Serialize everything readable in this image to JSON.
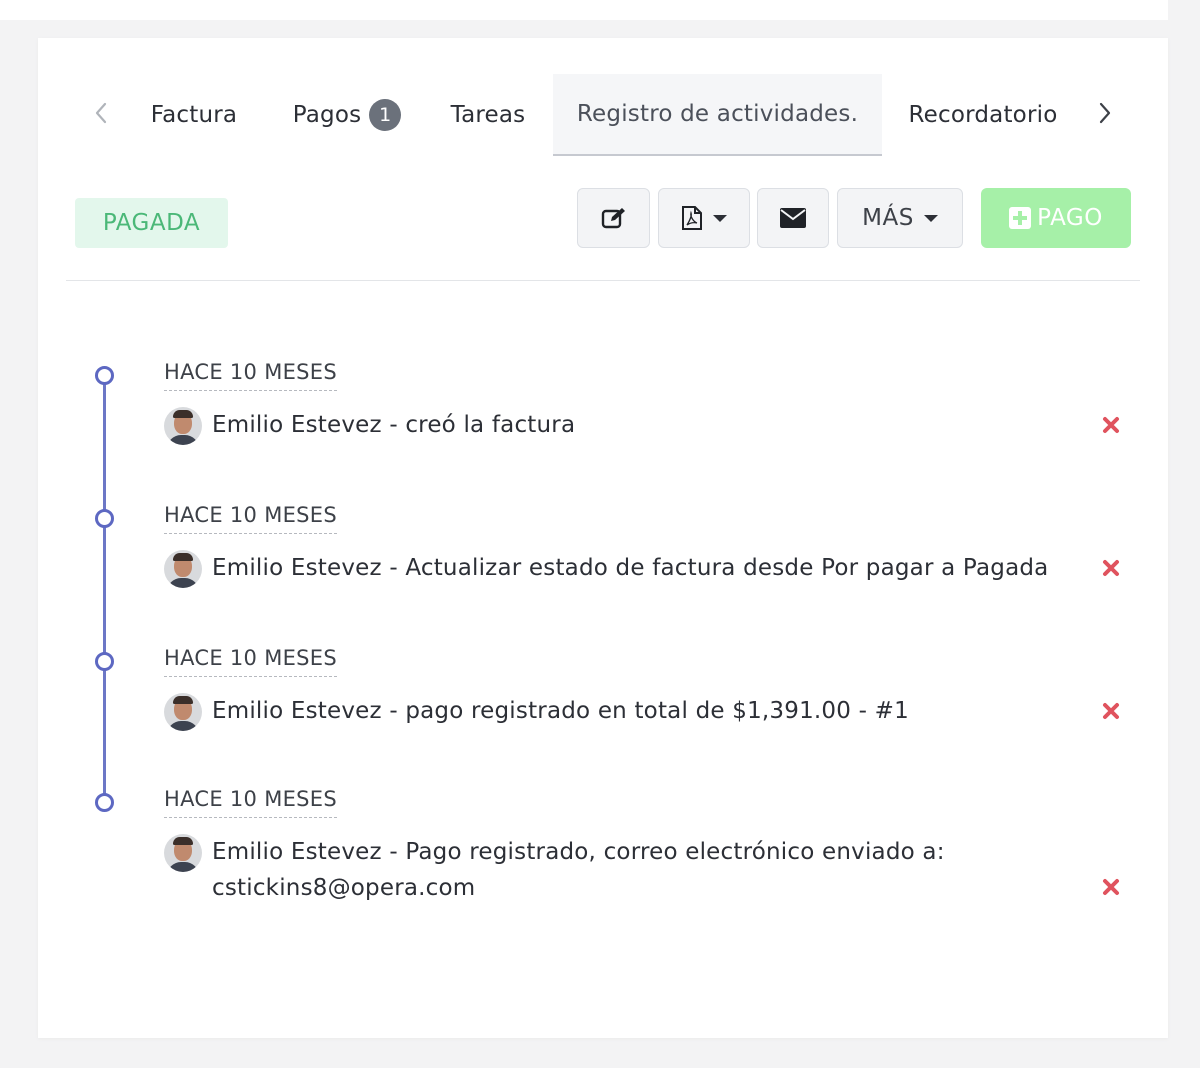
{
  "tabs": {
    "items": [
      {
        "label": "Factura"
      },
      {
        "label": "Pagos",
        "badge": "1"
      },
      {
        "label": "Tareas"
      },
      {
        "label": "Registro de actividades."
      },
      {
        "label": "Recordatorio"
      }
    ],
    "active_index": 3
  },
  "toolbar": {
    "status": "PAGADA",
    "more_label": "MÁS",
    "pay_label": "PAGO"
  },
  "timeline": [
    {
      "time": "HACE 10 MESES",
      "text": "Emilio Estevez - creó la factura"
    },
    {
      "time": "HACE 10 MESES",
      "text": "Emilio Estevez - Actualizar estado de factura desde Por pagar a Pagada"
    },
    {
      "time": "HACE 10 MESES",
      "text": "Emilio Estevez - pago registrado en total de $1,391.00 - #1"
    },
    {
      "time": "HACE 10 MESES",
      "text": "Emilio Estevez - Pago registrado, correo electrónico enviado a:",
      "text_line2": "cstickins8@opera.com"
    }
  ],
  "colors": {
    "timeline": "#5d68c2",
    "status_bg": "#e3f7ec",
    "status_text": "#4bb878",
    "pay_button": "#a6f0a8",
    "delete": "#e0535e"
  },
  "icons": [
    "chevron-left-icon",
    "chevron-right-icon",
    "edit-icon",
    "pdf-icon",
    "envelope-icon",
    "plus-square-icon",
    "avatar",
    "close-icon"
  ]
}
